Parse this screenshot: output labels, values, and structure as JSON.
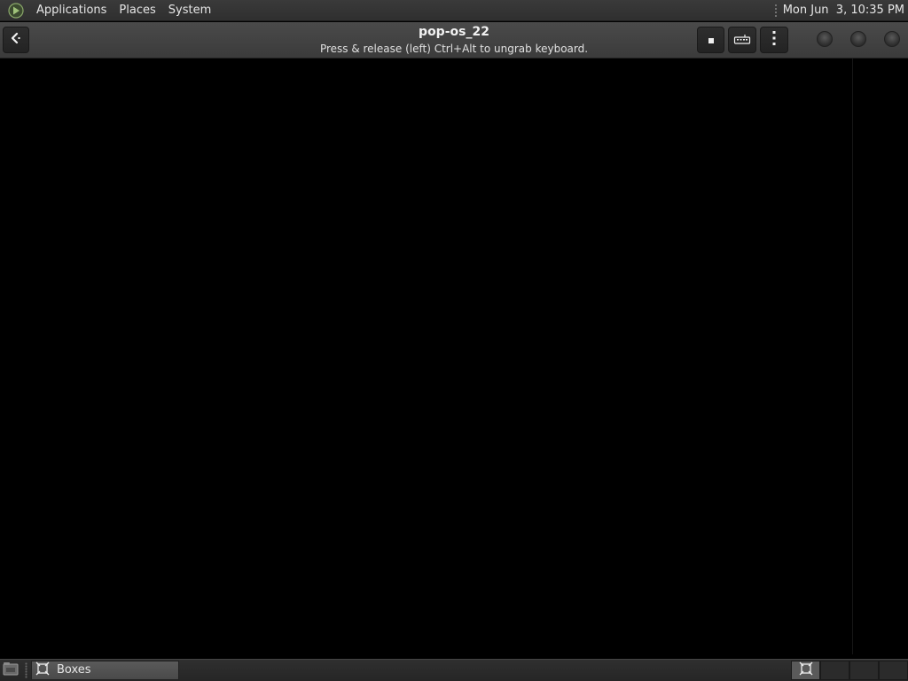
{
  "top_panel": {
    "menus": [
      {
        "label": "Applications"
      },
      {
        "label": "Places"
      },
      {
        "label": "System"
      }
    ],
    "clock": "Mon Jun  3, 10:35 PM",
    "logo_icon": "mate-logo-icon"
  },
  "window": {
    "title": "pop-os_22",
    "subtitle": "Press & release (left) Ctrl+Alt to ungrab keyboard.",
    "buttons": {
      "back_icon": "back-arrow-icon",
      "stop_icon": "stop-icon",
      "keyboard_icon": "keyboard-icon",
      "menu_icon": "vertical-ellipsis-icon"
    },
    "window_controls": [
      "minimize",
      "maximize",
      "close"
    ]
  },
  "taskbar": {
    "show_desktop_icon": "show-desktop-icon",
    "tasks": [
      {
        "label": "Boxes",
        "icon": "boxes-app-icon"
      }
    ],
    "workspaces": {
      "count": 4,
      "active": 1
    }
  },
  "colors": {
    "panel_bg": "#2f2f2f",
    "header_bg": "#444444",
    "vm_bg": "#000000",
    "text": "#e6e6e6"
  }
}
